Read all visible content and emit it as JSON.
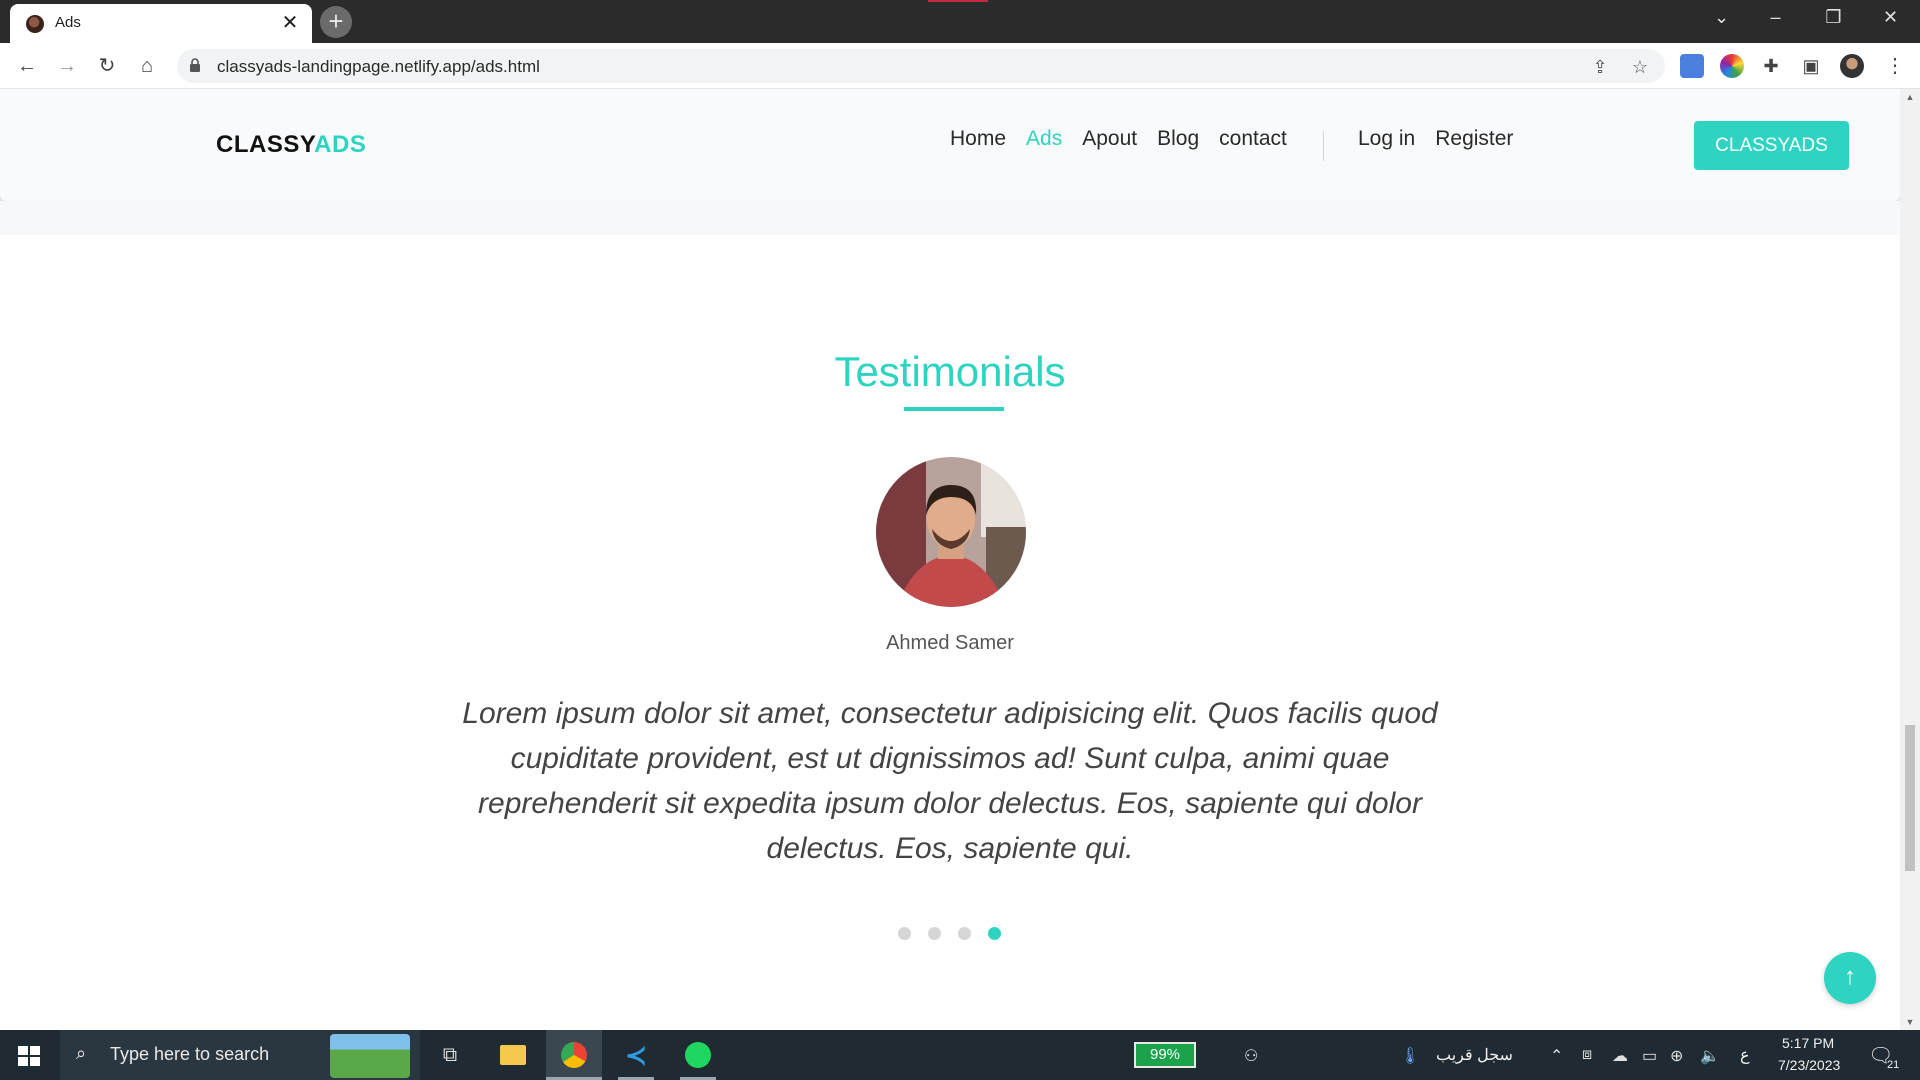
{
  "browser": {
    "tab_title": "Ads",
    "url": "classyads-landingpage.netlify.app/ads.html"
  },
  "site": {
    "logo_main": "CLASSY",
    "logo_accent": "ADS",
    "nav": [
      {
        "label": "Home",
        "active": false
      },
      {
        "label": "Ads",
        "active": true
      },
      {
        "label": "Apout",
        "active": false
      },
      {
        "label": "Blog",
        "active": false
      },
      {
        "label": "contact",
        "active": false
      }
    ],
    "auth": [
      {
        "label": "Log in"
      },
      {
        "label": "Register"
      }
    ],
    "cta_label": "CLASSYADS"
  },
  "testimonials": {
    "title": "Testimonials",
    "reviewer_name": "Ahmed Samer",
    "quote": "Lorem ipsum dolor sit amet, consectetur adipisicing elit. Quos facilis quod cupiditate provident, est ut dignissimos ad! Sunt culpa, animi quae reprehenderit sit expedita ipsum dolor delectus. Eos, sapiente qui dolor delectus. Eos, sapiente qui.",
    "dots_total": 4,
    "active_dot": 4
  },
  "taskbar": {
    "search_placeholder": "Type here to search",
    "battery": "99%",
    "weather_text": "سجل قريب",
    "lang": "ع",
    "time": "5:17 PM",
    "date": "7/23/2023",
    "notification_count": "21"
  },
  "colors": {
    "accent": "#2ed3c2"
  }
}
